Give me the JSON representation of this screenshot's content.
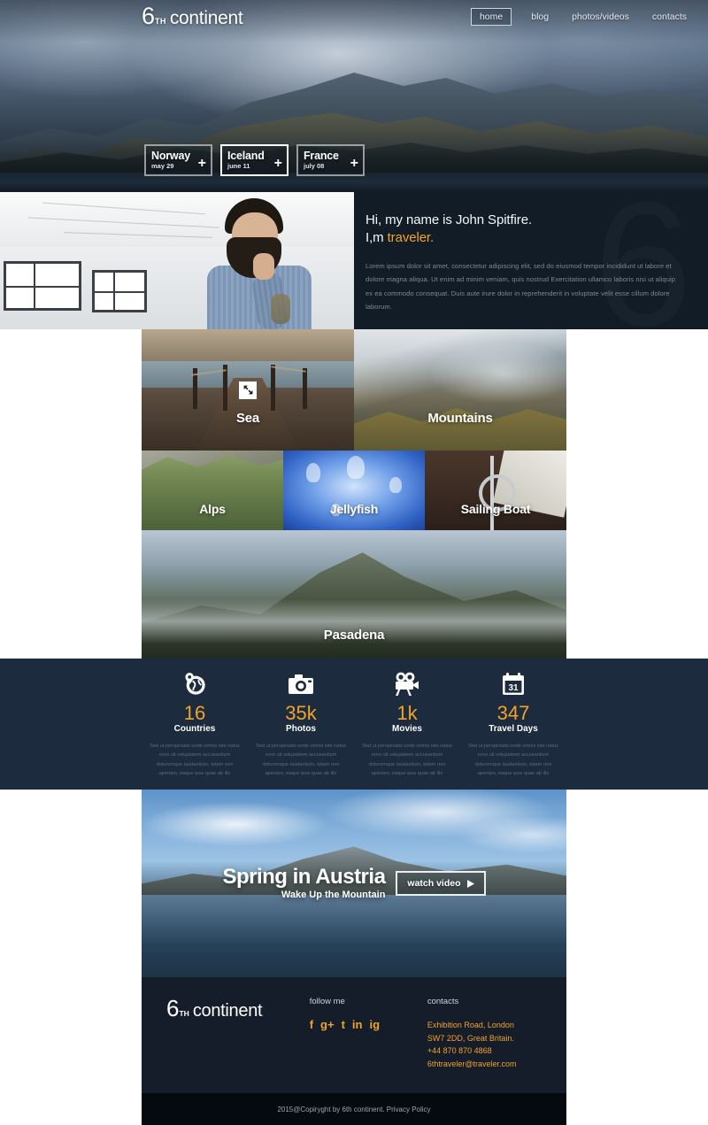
{
  "brand": {
    "six": "6",
    "th": "TH",
    "word": "continent"
  },
  "nav": {
    "items": [
      {
        "label": "home",
        "active": true
      },
      {
        "label": "blog",
        "active": false
      },
      {
        "label": "photos/videos",
        "active": false
      },
      {
        "label": "contacts",
        "active": false
      }
    ]
  },
  "hero": {
    "destinations": [
      {
        "name": "Norway",
        "date": "may 29",
        "plus": "+",
        "active": false
      },
      {
        "name": "Iceland",
        "date": "june 11",
        "plus": "+",
        "active": true
      },
      {
        "name": "France",
        "date": "july 08",
        "plus": "+",
        "active": false
      }
    ]
  },
  "about": {
    "watermark": "6",
    "heading_line1": "Hi, my name is John Spitfire.",
    "heading_line2_pre": "I,m ",
    "heading_accent": "traveler.",
    "paragraph": "Lorem ipsum dolor sit amet, consectetur adipiscing elit, sed do eiusmod tempor incididunt ut labore et dolore magna aliqua. Ut enim ad minim veniam, quis nostrud Exercitation ullamco laboris nisi ut aliquip ex ea commodo consequat. Duis aute irure dolor in reprehenderit in voluptate velit esse cillum dolore laborum."
  },
  "gallery": {
    "tiles": [
      {
        "label": "Sea",
        "expand_icon": "expand-icon"
      },
      {
        "label": "Mountains"
      },
      {
        "label": "Alps"
      },
      {
        "label": "Jellyfish"
      },
      {
        "label": "Sailing Boat"
      },
      {
        "label": "Pasadena"
      }
    ]
  },
  "stats": {
    "description": "Sed ut perspiciatis unde omnis iste natus error sit voluptatem accusantium doloremque laudantium, totam rem aperiam, eaque ipsa quae ab illo",
    "items": [
      {
        "icon": "globe-pin-icon",
        "number": "16",
        "label": "Countries"
      },
      {
        "icon": "camera-icon",
        "number": "35k",
        "label": "Photos"
      },
      {
        "icon": "movie-camera-icon",
        "number": "1k",
        "label": "Movies"
      },
      {
        "icon": "calendar-icon",
        "number": "347",
        "label": "Travel Days",
        "calendar_day": "31"
      }
    ]
  },
  "video": {
    "title": "Spring in Austria",
    "subtitle": "Wake Up the Mountain",
    "button_label": "watch video",
    "button_icon": "play-arrow-icon"
  },
  "footer": {
    "follow_heading": "follow me",
    "contacts_heading": "contacts",
    "social": [
      {
        "name": "facebook-icon",
        "glyph": "f"
      },
      {
        "name": "google-plus-icon",
        "glyph": "g+"
      },
      {
        "name": "twitter-icon",
        "glyph": "t"
      },
      {
        "name": "linkedin-icon",
        "glyph": "in"
      },
      {
        "name": "instagram-icon",
        "glyph": "ig"
      }
    ],
    "contact_lines": [
      "Exhibition Road, London",
      "SW7 2DD, Great Britain.",
      "+44 870 870 4868",
      "6thtraveler@traveler.com"
    ],
    "copyright": "2015@Copiryght by 6th continent. Privacy Policy"
  },
  "colors": {
    "accent": "#f2a32a",
    "navy": "#1c2b3d",
    "dark": "#111c27",
    "footer": "#141d29"
  }
}
